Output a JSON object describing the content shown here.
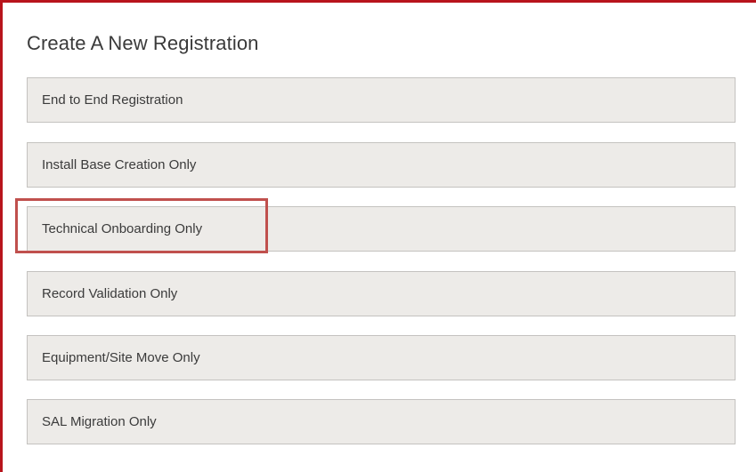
{
  "panel": {
    "title": "Create A New Registration"
  },
  "options": [
    {
      "label": "End to End Registration"
    },
    {
      "label": "Install Base Creation Only"
    },
    {
      "label": "Technical Onboarding Only"
    },
    {
      "label": "Record Validation Only"
    },
    {
      "label": "Equipment/Site Move Only"
    },
    {
      "label": "SAL Migration Only"
    }
  ],
  "colors": {
    "accent_border": "#b8141c",
    "highlight_box": "#c0504d",
    "option_background": "#edebe8"
  }
}
